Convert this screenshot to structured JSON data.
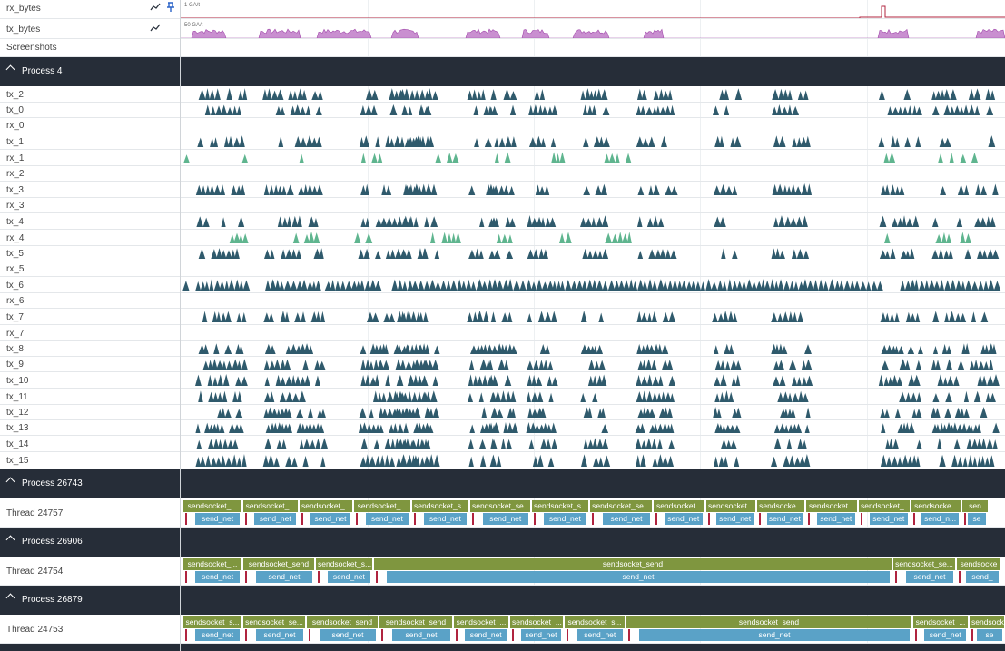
{
  "counters": {
    "rx": {
      "label": "rx_bytes",
      "scale": "1 GA/t"
    },
    "tx": {
      "label": "tx_bytes",
      "scale": "50 GA/t"
    },
    "screenshots": {
      "label": "Screenshots"
    },
    "chart_icon": "chart-line-icon",
    "pin_icon": "pin-icon"
  },
  "process4": {
    "title": "Process 4",
    "tracks": [
      "tx_2",
      "tx_0",
      "rx_0",
      "tx_1",
      "rx_1",
      "rx_2",
      "tx_3",
      "rx_3",
      "tx_4",
      "rx_4",
      "tx_5",
      "rx_5",
      "tx_6",
      "rx_6",
      "tx_7",
      "rx_7",
      "tx_8",
      "tx_9",
      "tx_10",
      "tx_11",
      "tx_12",
      "tx_13",
      "tx_14",
      "tx_15"
    ]
  },
  "processes": [
    {
      "title": "Process 26743",
      "thread": "Thread 24757",
      "slices": [
        {
          "a": "sendsocket_...",
          "b": "send_net"
        },
        {
          "a": "sendsocket_...",
          "b": "send_net"
        },
        {
          "a": "sendsocket_...",
          "b": "send_net"
        },
        {
          "a": "sendsocket_...",
          "b": "send_net"
        },
        {
          "a": "sendsocket_s...",
          "b": "send_net"
        },
        {
          "a": "sendsocket_se...",
          "b": "send_net"
        },
        {
          "a": "sendsocket_s...",
          "b": "send_net"
        },
        {
          "a": "sendsocket_se...",
          "b": "send_net"
        },
        {
          "a": "sendsocket...",
          "b": "send_net"
        },
        {
          "a": "sendsocket...",
          "b": "send_net"
        },
        {
          "a": "sendsocke...",
          "b": "send_net"
        },
        {
          "a": "sendsocket...",
          "b": "send_net"
        },
        {
          "a": "sendsocket_...",
          "b": "send_net"
        },
        {
          "a": "sendsocke...",
          "b": "send_n..."
        },
        {
          "a": "sen",
          "b": "se"
        }
      ]
    },
    {
      "title": "Process 26906",
      "thread": "Thread 24754",
      "slices": [
        {
          "a": "sendsocket_...",
          "b": "send_net"
        },
        {
          "a": "sendsocket_send",
          "b": "send_net"
        },
        {
          "a": "sendsocket_s...",
          "b": "send_net"
        },
        {
          "a": "sendsocket_send",
          "b": "send_net"
        },
        {
          "a": "sendsocket_se...",
          "b": "send_net"
        },
        {
          "a": "sendsocke",
          "b": "send_"
        }
      ]
    },
    {
      "title": "Process 26879",
      "thread": "Thread 24753",
      "slices": [
        {
          "a": "sendsocket_s...",
          "b": "send_net"
        },
        {
          "a": "sendsocket_se...",
          "b": "send_net"
        },
        {
          "a": "sendsocket_send",
          "b": "send_net"
        },
        {
          "a": "sendsocket_send",
          "b": "send_net"
        },
        {
          "a": "sendsocket_...",
          "b": "send_net"
        },
        {
          "a": "sendsocket_...",
          "b": "send_net"
        },
        {
          "a": "sendsocket_s...",
          "b": "send_net"
        },
        {
          "a": "sendsocket_send",
          "b": "send_net"
        },
        {
          "a": "sendsocket_...",
          "b": "send_net"
        },
        {
          "a": "sendsocke",
          "b": "se"
        }
      ]
    }
  ],
  "colors": {
    "tx": "#2f5a6c",
    "rx": "#5fb58f",
    "header": "#262d38",
    "slice_top": "#7f963f",
    "slice_bot": "#5aa2c7",
    "marker": "#b0243f",
    "counter": "#b04fb8"
  }
}
